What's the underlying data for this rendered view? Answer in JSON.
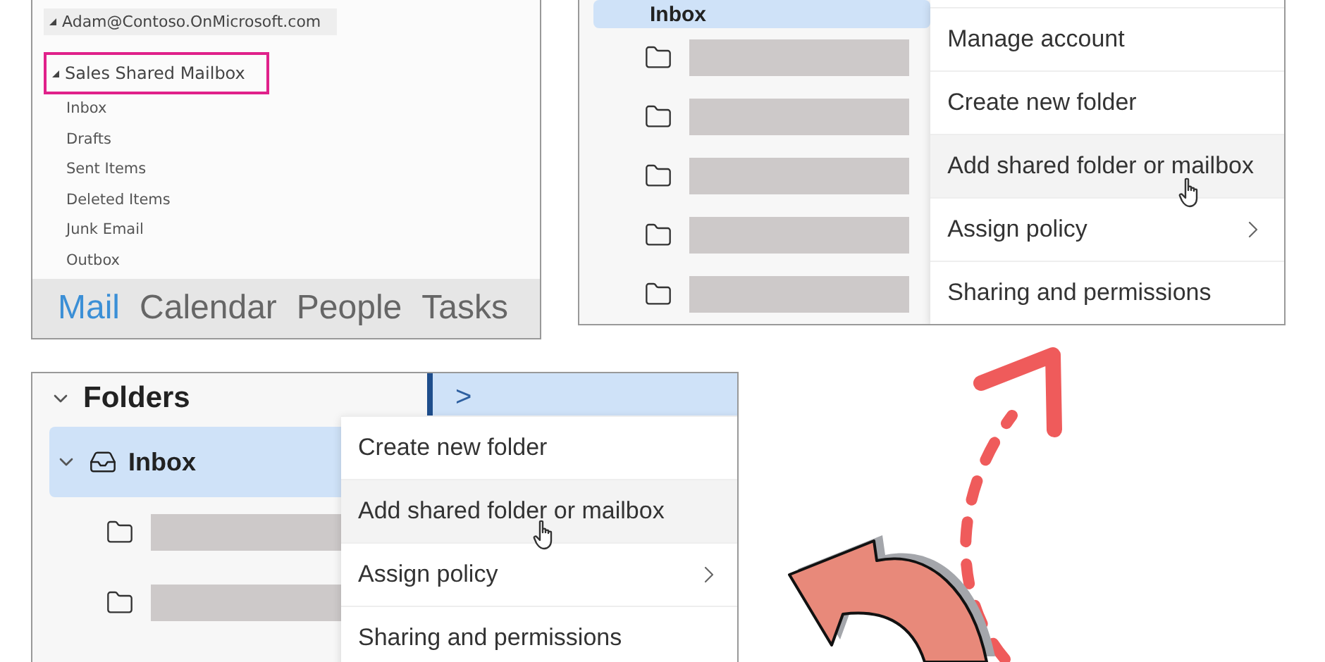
{
  "desktop_panel": {
    "account": {
      "label": "Adam@Contoso.OnMicrosoft.com",
      "expanded": true
    },
    "shared_mailbox": {
      "label": "Sales Shared Mailbox",
      "expanded": true,
      "highlighted": true
    },
    "folders": [
      "Inbox",
      "Drafts",
      "Sent Items",
      "Deleted Items",
      "Junk Email",
      "Outbox"
    ],
    "nav_tabs": [
      {
        "label": "Mail",
        "selected": true
      },
      {
        "label": "Calendar",
        "selected": false
      },
      {
        "label": "People",
        "selected": false
      },
      {
        "label": "Tasks",
        "selected": false
      }
    ]
  },
  "web_panel_top": {
    "inbox": {
      "label": "Inbox",
      "selected": true
    },
    "folders": [
      {
        "kind": "redacted"
      },
      {
        "kind": "redacted"
      },
      {
        "kind": "redacted"
      },
      {
        "kind": "redacted"
      },
      {
        "kind": "redacted"
      }
    ],
    "menu": [
      {
        "label": "Manage account",
        "hovered": false,
        "submenu": false
      },
      {
        "label": "Create new folder",
        "hovered": false,
        "submenu": false
      },
      {
        "label": "Add shared folder or mailbox",
        "hovered": true,
        "submenu": false
      },
      {
        "label": "Assign policy",
        "hovered": false,
        "submenu": true
      },
      {
        "label": "Sharing and permissions",
        "hovered": false,
        "submenu": false
      }
    ]
  },
  "web_panel_bottom": {
    "header": {
      "label": "Folders",
      "expanded": true
    },
    "pane_toggle": ">",
    "inbox": {
      "label": "Inbox",
      "selected": true,
      "expanded": true
    },
    "folders": [
      {
        "kind": "redacted"
      },
      {
        "kind": "redacted"
      }
    ],
    "menu": [
      {
        "label": "Create new folder",
        "hovered": false,
        "submenu": false
      },
      {
        "label": "Add shared folder or mailbox",
        "hovered": true,
        "submenu": false
      },
      {
        "label": "Assign policy",
        "hovered": false,
        "submenu": true
      },
      {
        "label": "Sharing and permissions",
        "hovered": false,
        "submenu": false
      }
    ]
  }
}
